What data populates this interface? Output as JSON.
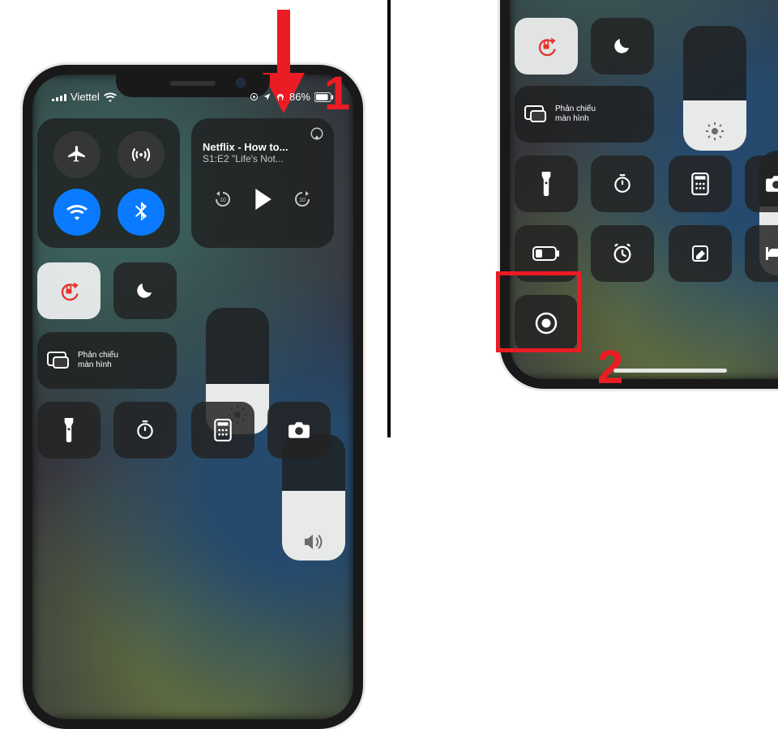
{
  "annotations": {
    "step1": "1",
    "step2": "2"
  },
  "status": {
    "carrier": "Viettel",
    "battery_pct": "86%"
  },
  "media": {
    "title": "Netflix - How to...",
    "subtitle": "S1:E2 \"Life's Not..."
  },
  "mirror": {
    "title": "Phản chiếu",
    "subtitle": "màn hình"
  },
  "sliders": {
    "brightness_pct": 40,
    "volume_pct": 55
  },
  "icons": {
    "airplane": "airplane",
    "cellular": "cellular",
    "wifi": "wifi",
    "bluetooth": "bluetooth",
    "airplay": "airplay",
    "back10": "back-10",
    "play": "play",
    "fwd10": "forward-10",
    "rotation_lock": "rotation-lock",
    "dnd": "do-not-disturb",
    "mirror": "screen-mirroring",
    "brightness": "brightness",
    "volume": "volume",
    "flashlight": "flashlight",
    "timer": "timer",
    "calculator": "calculator",
    "camera": "camera",
    "low_power": "low-power-mode",
    "alarm": "alarm",
    "notes": "notes",
    "bed": "sleep",
    "record": "screen-recording"
  }
}
